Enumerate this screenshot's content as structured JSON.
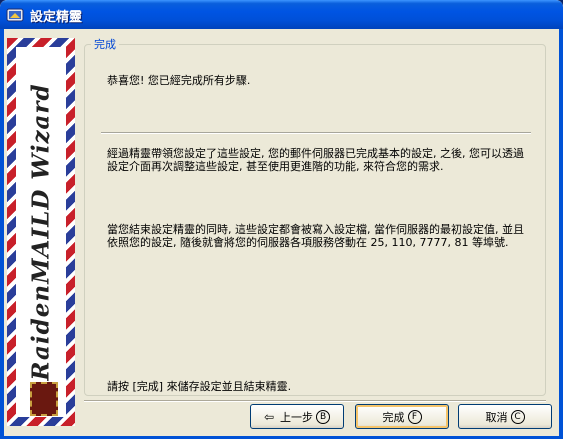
{
  "window": {
    "title": "設定精靈"
  },
  "banner": {
    "text": "RaidenMAILD Wizard"
  },
  "group": {
    "legend": "完成",
    "para1": "恭喜您! 您已經完成所有步驟.",
    "para2": "經過精靈帶領您設定了這些設定, 您的郵件伺服器已完成基本的設定, 之後, 您可以透過設定介面再次調整這些設定, 甚至使用更進階的功能, 來符合您的需求.",
    "para3": "當您結束設定精靈的同時, 這些設定都會被寫入設定檔, 當作伺服器的最初設定值, 並且依照您的設定, 隨後就會將您的伺服器各項服務啓動在 25, 110, 7777, 81 等埠號.",
    "para4": "請按 [完成] 來儲存設定並且結束精靈."
  },
  "buttons": {
    "back": {
      "label": "上一步",
      "key": "B"
    },
    "finish": {
      "label": "完成",
      "key": "F"
    },
    "cancel": {
      "label": "取消",
      "key": "C"
    }
  },
  "icons": {
    "title": "wizard-app-icon",
    "back": "back-arrow-icon",
    "stamp": "postage-stamp-icon"
  },
  "colors": {
    "titlebar": "#0054e3",
    "dialog_bg": "#ece9d8",
    "legend": "#0046d5",
    "banner_red": "#c8202a",
    "banner_blue": "#2a3e9a"
  }
}
